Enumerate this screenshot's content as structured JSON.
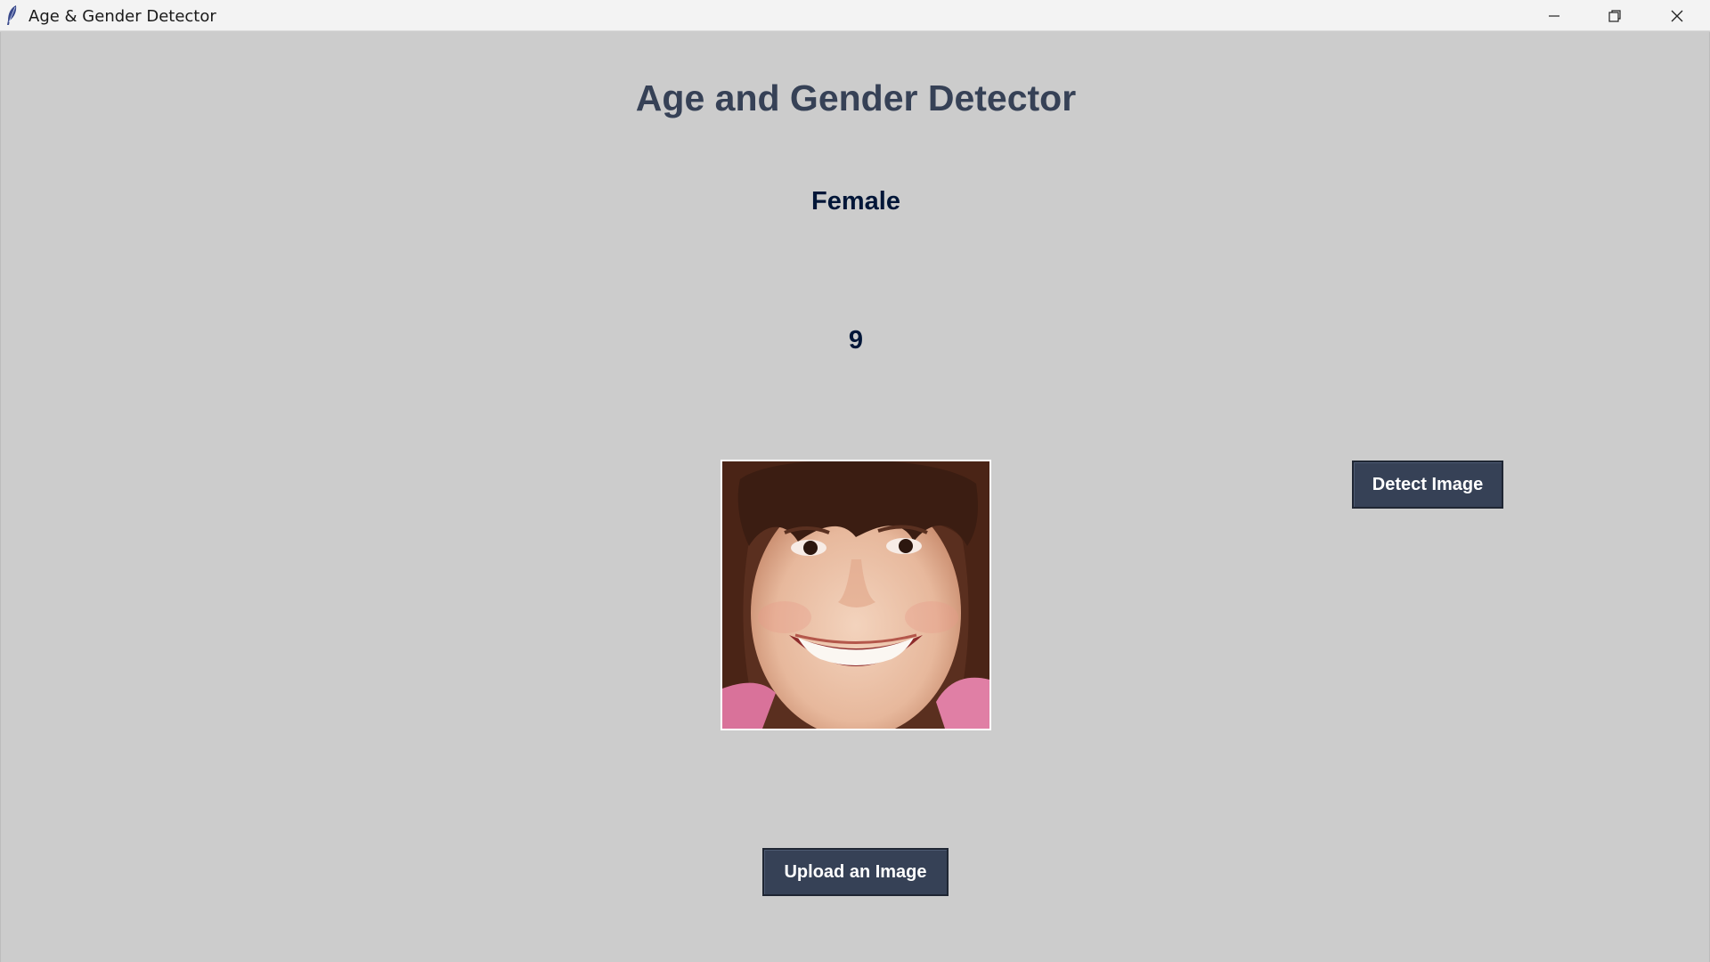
{
  "window": {
    "title": "Age & Gender Detector",
    "controls": [
      "minimize-icon",
      "restore-icon",
      "close-icon"
    ]
  },
  "heading": "Age and Gender Detector",
  "result": {
    "gender": "Female",
    "age": "9"
  },
  "image_preview": {
    "subject": "smiling girl with dark bangs"
  },
  "buttons": {
    "detect": "Detect Image",
    "upload": "Upload an Image"
  },
  "colors": {
    "background": "#cccccc",
    "heading": "#364156",
    "result_text": "#011638",
    "button_bg": "#364156",
    "button_text": "#ffffff"
  }
}
